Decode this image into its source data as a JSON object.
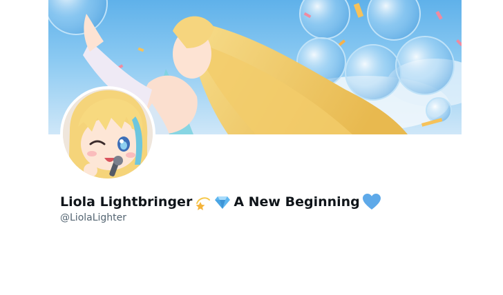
{
  "profile": {
    "name_part1": "Liola Lightbringer",
    "name_part2": "A New Beginning",
    "handle": "@LiolaLighter",
    "emojis": [
      "dizzy-star-emoji",
      "gem-emoji",
      "blue-heart-emoji"
    ]
  },
  "colors": {
    "text_primary": "#0f1419",
    "text_secondary": "#536471",
    "banner_sky": "#5fb1ea",
    "hair": "#f4d27a",
    "heart": "#5ea9e9"
  }
}
